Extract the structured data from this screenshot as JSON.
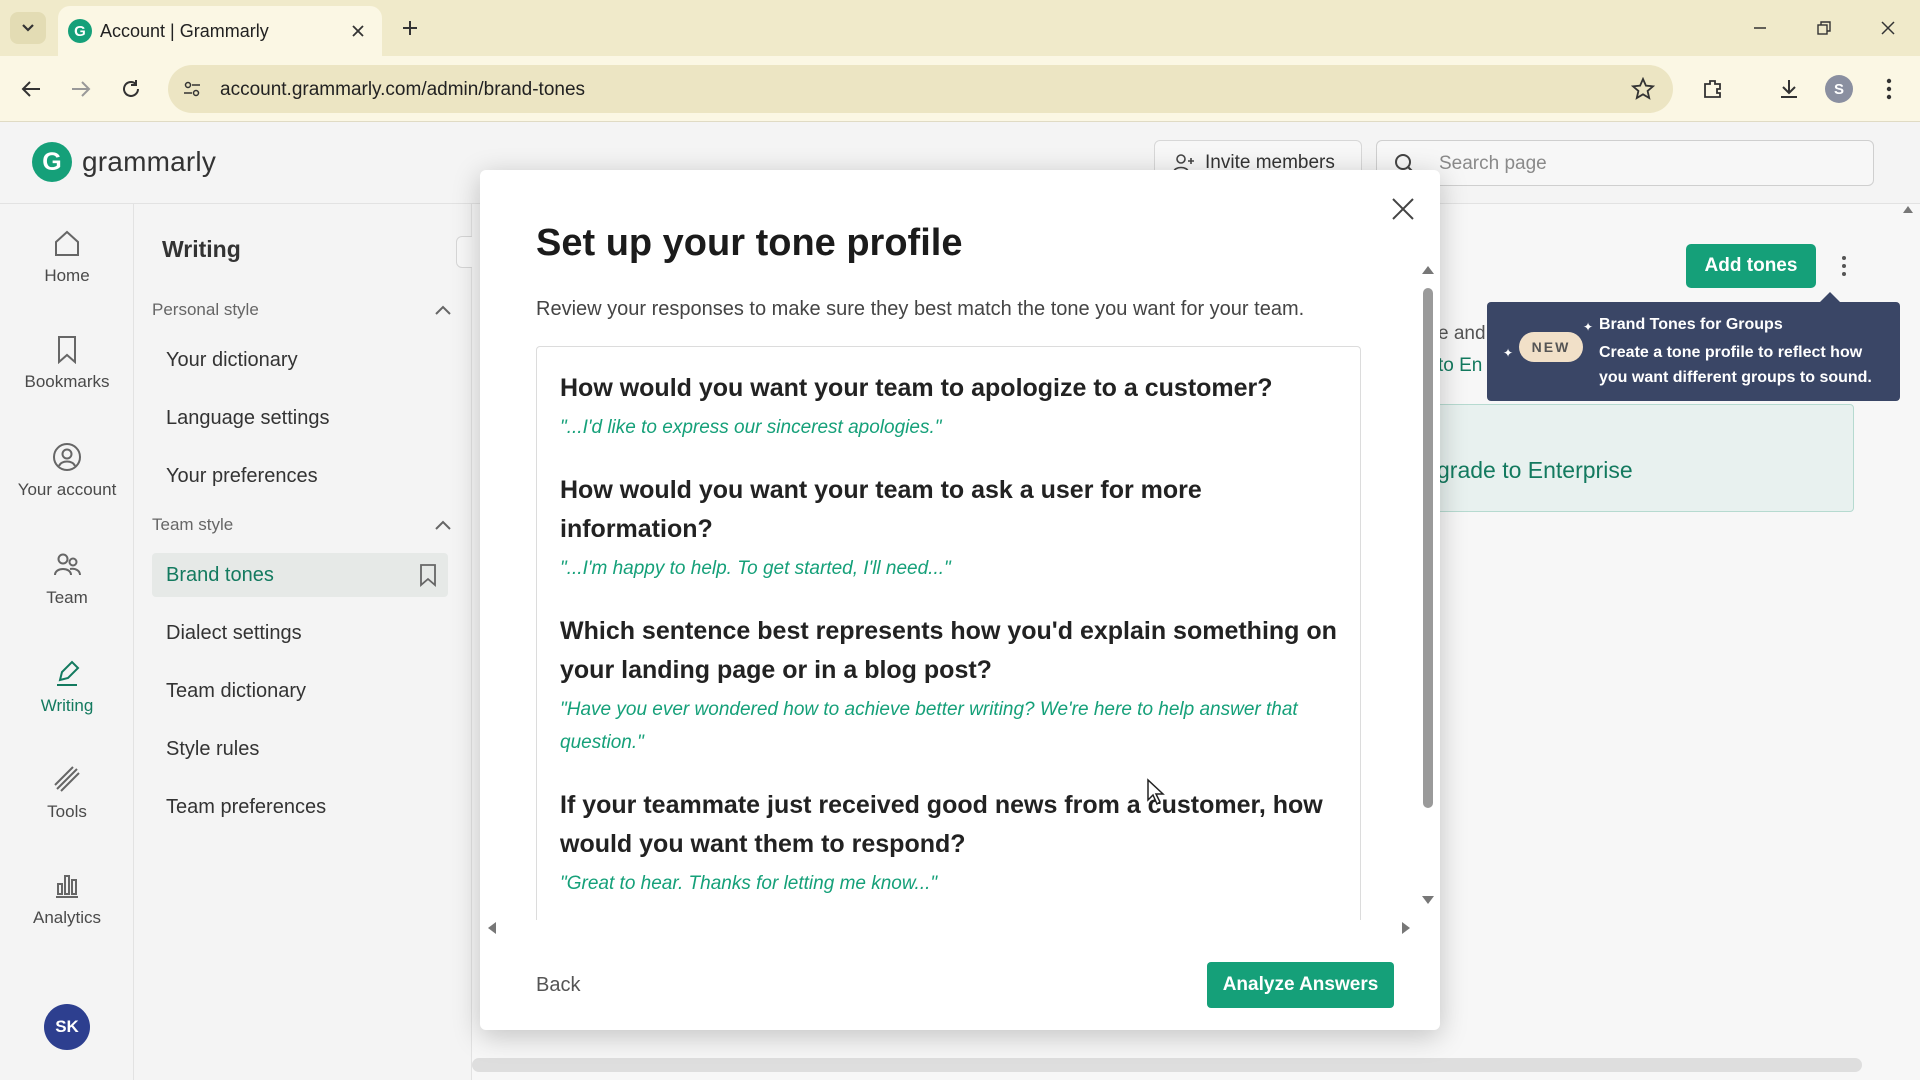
{
  "browser": {
    "tab_title": "Account | Grammarly",
    "url": "account.grammarly.com/admin/brand-tones",
    "profile_initial": "S"
  },
  "header": {
    "logo_text": "grammarly",
    "invite_label": "Invite members",
    "search_placeholder": "Search page"
  },
  "rail": {
    "items": [
      {
        "label": "Home"
      },
      {
        "label": "Bookmarks"
      },
      {
        "label": "Your account"
      },
      {
        "label": "Team"
      },
      {
        "label": "Writing"
      },
      {
        "label": "Tools"
      },
      {
        "label": "Analytics"
      }
    ],
    "avatar_initials": "SK"
  },
  "sidebar": {
    "title": "Writing",
    "personal_heading": "Personal style",
    "personal_items": [
      "Your dictionary",
      "Language settings",
      "Your preferences"
    ],
    "team_heading": "Team style",
    "team_items": [
      "Brand tones",
      "Dialect settings",
      "Team dictionary",
      "Style rules",
      "Team preferences"
    ]
  },
  "background": {
    "add_tones_label": "Add tones",
    "tooltip": {
      "badge": "NEW",
      "title": "Brand Tones for Groups",
      "body": "Create a tone profile to reflect how you want different groups to sound."
    },
    "peek_line1": "e and",
    "peek_line2": "to En",
    "enterprise_text": "grade to Enterprise"
  },
  "modal": {
    "title": "Set up your tone profile",
    "subtitle": "Review your responses to make sure they best match the tone you want for your team.",
    "qa": [
      {
        "question": "How would you want your team to apologize to a customer?",
        "answer": "\"...I'd like to express our sincerest apologies.\""
      },
      {
        "question": "How would you want your team to ask a user for more information?",
        "answer": "\"...I'm happy to help. To get started, I'll need...\""
      },
      {
        "question": "Which sentence best represents how you'd explain something on your landing page or in a blog post?",
        "answer": "\"Have you ever wondered how to achieve better writing? We're here to help answer that question.\""
      },
      {
        "question": "If your teammate just received good news from a customer, how would you want them to respond?",
        "answer": "\"Great to hear. Thanks for letting me know...\""
      }
    ],
    "back_label": "Back",
    "analyze_label": "Analyze Answers"
  },
  "colors": {
    "brand_green": "#15a079",
    "tooltip_bg": "#3a4666",
    "tab_bar": "#f0eaca"
  }
}
